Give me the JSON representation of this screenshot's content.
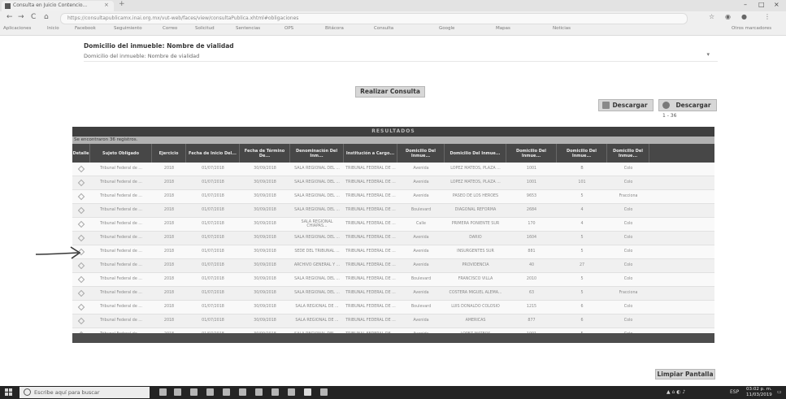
{
  "browser": {
    "tab_title": "Consulta en Juicio Contencio...",
    "tab_close": "×",
    "new_tab": "+",
    "window_controls": [
      "–",
      "□",
      "×"
    ],
    "nav_back": "←",
    "nav_forward": "→",
    "nav_reload": "C",
    "nav_home": "⌂",
    "url": "https://consultapublicamx.inai.org.mx/vut-web/faces/view/consultaPublica.xhtml#obligaciones",
    "bookmarks": [
      "Aplicaciones",
      "Inicio",
      "Facebook",
      "Seguimiento",
      "Correo",
      "Solicitud",
      "Sentencias",
      "OPS",
      "Bitácora",
      "Consulta",
      "Google",
      "Mapas",
      "Noticias",
      "Otros marcadores"
    ]
  },
  "page": {
    "field_label": "Domicilio del inmueble: Nombre de vialidad",
    "field_value": "Domicilio del inmueble: Nombre de vialidad",
    "field_caret": "▾",
    "consulta_button": "Realizar Consulta",
    "download1_button": "Descargar",
    "download2_button": "Descargar",
    "paging": "1 - 36",
    "clear_button": "Limpiar Pantalla"
  },
  "grid": {
    "caption": "RESULTADOS",
    "subcaption": "Se encontraron 36 registros.",
    "columns": [
      "Detalle",
      "Sujeto Obligado",
      "Ejercicio",
      "Fecha de Inicio Del...",
      "Fecha de Término De...",
      "Denominación Del Inm...",
      "Institución a Cargo...",
      "Domicilio Del Inmue...",
      "Domicilio Del Inmue...",
      "Domicilio Del Inmue...",
      "Domicilio Del Inmue...",
      "Domicilio Del Inmue..."
    ],
    "rows": [
      [
        "",
        "Tribunal Federal de ...",
        "2018",
        "01/07/2018",
        "30/09/2018",
        "SALA REGIONAL DEL ...",
        "TRIBUNAL FEDERAL DE ...",
        "Avenida",
        "LOPEZ MATEOS, PLAZA ...",
        "1001",
        "B",
        "Colo"
      ],
      [
        "",
        "Tribunal Federal de ...",
        "2018",
        "01/07/2018",
        "30/09/2018",
        "SALA REGIONAL DEL ...",
        "TRIBUNAL FEDERAL DE ...",
        "Avenida",
        "LOPEZ MATEOS, PLAZA ...",
        "1001",
        "101",
        "Colo"
      ],
      [
        "",
        "Tribunal Federal de ...",
        "2018",
        "01/07/2018",
        "30/09/2018",
        "SALA REGIONAL DEL ...",
        "TRIBUNAL FEDERAL DE ...",
        "Avenida",
        "PASEO DE LOS HEROES",
        "9653",
        "5",
        "Fracciona"
      ],
      [
        "",
        "Tribunal Federal de ...",
        "2018",
        "01/07/2018",
        "30/09/2018",
        "SALA REGIONAL DEL ...",
        "TRIBUNAL FEDERAL DE ...",
        "Boulevard",
        "DIAGONAL REFORMA",
        "2684",
        "4",
        "Colo"
      ],
      [
        "",
        "Tribunal Federal de ...",
        "2018",
        "01/07/2018",
        "30/09/2018",
        "SALA REGIONAL CHIAPAS...",
        "TRIBUNAL FEDERAL DE ...",
        "Calle",
        "PRIMERA PONIENTE SUR",
        "170",
        "4",
        "Colo"
      ],
      [
        "",
        "Tribunal Federal de ...",
        "2018",
        "01/07/2018",
        "30/09/2018",
        "SALA REGIONAL DEL ...",
        "TRIBUNAL FEDERAL DE ...",
        "Avenida",
        "DARIO",
        "1604",
        "5",
        "Colo"
      ],
      [
        "",
        "Tribunal Federal de ...",
        "2018",
        "01/07/2018",
        "30/09/2018",
        "SEDE DEL TRIBUNAL ...",
        "TRIBUNAL FEDERAL DE ...",
        "Avenida",
        "INSURGENTES SUR",
        "881",
        "5",
        "Colo"
      ],
      [
        "",
        "Tribunal Federal de ...",
        "2018",
        "01/07/2018",
        "30/09/2018",
        "ARCHIVO GENERAL Y ...",
        "TRIBUNAL FEDERAL DE ...",
        "Avenida",
        "PROVIDENCIA",
        "40",
        "27",
        "Colo"
      ],
      [
        "",
        "Tribunal Federal de ...",
        "2018",
        "01/07/2018",
        "30/09/2018",
        "SALA REGIONAL DEL ...",
        "TRIBUNAL FEDERAL DE ...",
        "Boulevard",
        "FRANCISCO VILLA",
        "2010",
        "5",
        "Colo"
      ],
      [
        "",
        "Tribunal Federal de ...",
        "2018",
        "01/07/2018",
        "30/09/2018",
        "SALA REGIONAL DEL ...",
        "TRIBUNAL FEDERAL DE ...",
        "Avenida",
        "COSTERA MIGUEL ALEMA...",
        "63",
        "5",
        "Fracciona"
      ],
      [
        "",
        "Tribunal Federal de ...",
        "2018",
        "01/07/2018",
        "30/09/2018",
        "SALA REGIONAL DE ...",
        "TRIBUNAL FEDERAL DE ...",
        "Boulevard",
        "LUIS DONALDO COLOSIO",
        "1215",
        "6",
        "Colo"
      ],
      [
        "",
        "Tribunal Federal de ...",
        "2018",
        "01/07/2018",
        "30/09/2018",
        "SALA REGIONAL DE ...",
        "TRIBUNAL FEDERAL DE ...",
        "Avenida",
        "AMERICAS",
        "877",
        "6",
        "Colo"
      ],
      [
        "",
        "Tribunal Federal de ...",
        "2018",
        "01/07/2018",
        "30/09/2018",
        "SALA REGIONAL DEL ...",
        "TRIBUNAL FEDERAL DE ...",
        "Avenida",
        "LOPEZ MATEOS",
        "1001",
        "5",
        "Colo"
      ]
    ]
  },
  "taskbar": {
    "search_placeholder": "Escribe aquí para buscar",
    "tray_text": "ESP",
    "clock_time": "03:02 p. m.",
    "clock_date": "11/03/2019"
  }
}
